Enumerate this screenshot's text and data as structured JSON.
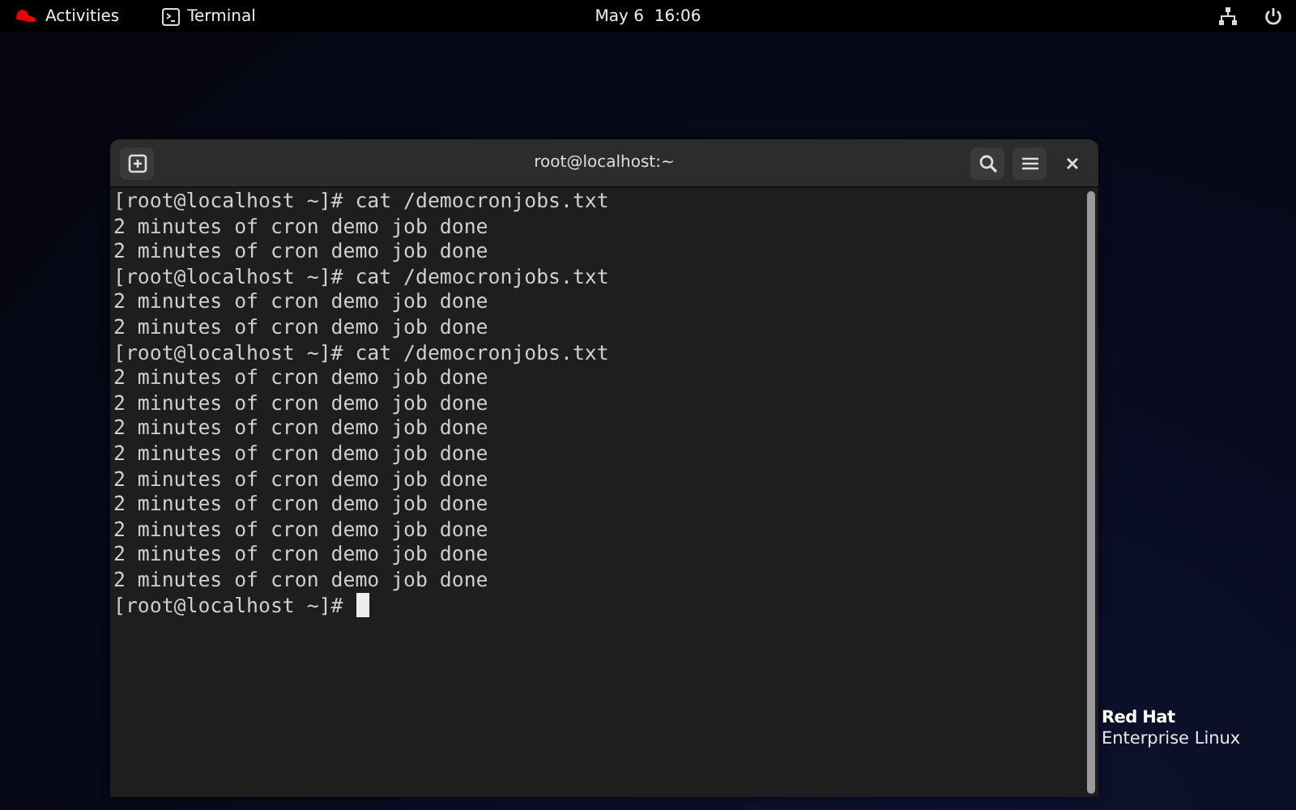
{
  "top_bar": {
    "activities": "Activities",
    "app": "Terminal",
    "clock": "May 6  16:06"
  },
  "window": {
    "title": "root@localhost:~"
  },
  "terminal": {
    "lines": [
      "[root@localhost ~]# cat /democronjobs.txt",
      "2 minutes of cron demo job done",
      "2 minutes of cron demo job done",
      "[root@localhost ~]# cat /democronjobs.txt",
      "2 minutes of cron demo job done",
      "2 minutes of cron demo job done",
      "[root@localhost ~]# cat /democronjobs.txt",
      "2 minutes of cron demo job done",
      "2 minutes of cron demo job done",
      "2 minutes of cron demo job done",
      "2 minutes of cron demo job done",
      "2 minutes of cron demo job done",
      "2 minutes of cron demo job done",
      "2 minutes of cron demo job done",
      "2 minutes of cron demo job done",
      "2 minutes of cron demo job done"
    ],
    "prompt": "[root@localhost ~]#"
  },
  "branding": {
    "line_1": "Red Hat",
    "line_2": "Enterprise Linux"
  }
}
